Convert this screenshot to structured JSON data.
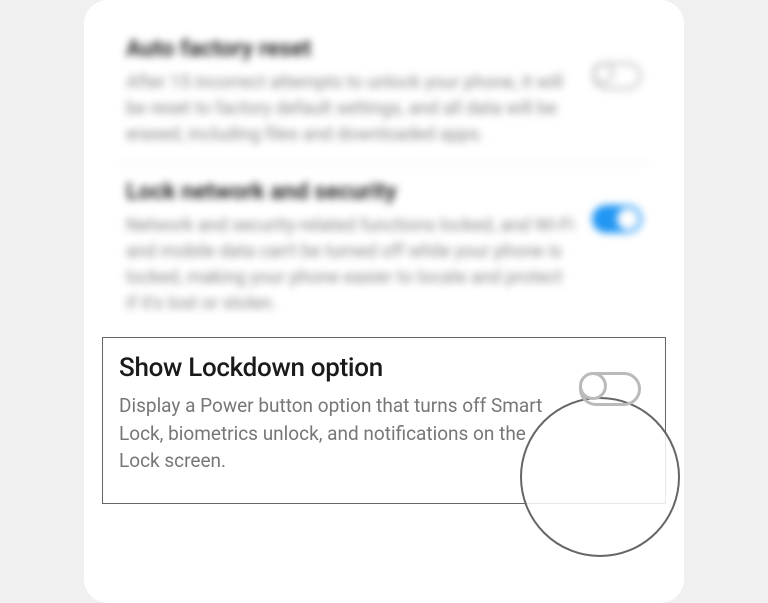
{
  "settings": {
    "auto_factory_reset": {
      "title": "Auto factory reset",
      "description": "After 15 incorrect attempts to unlock your phone, it will be reset to factory default settings, and all data will be erased, including files and downloaded apps.",
      "enabled": false
    },
    "lock_network_security": {
      "title": "Lock network and security",
      "description": "Network and security-related functions locked, and Wi-Fi and mobile data can't be turned off while your phone is locked, making your phone easier to locate and protect if it's lost or stolen.",
      "enabled": true
    },
    "show_lockdown": {
      "title": "Show Lockdown option",
      "description": "Display a Power button option that turns off Smart Lock, biometrics unlock, and notifications on the Lock screen.",
      "enabled": false
    }
  }
}
